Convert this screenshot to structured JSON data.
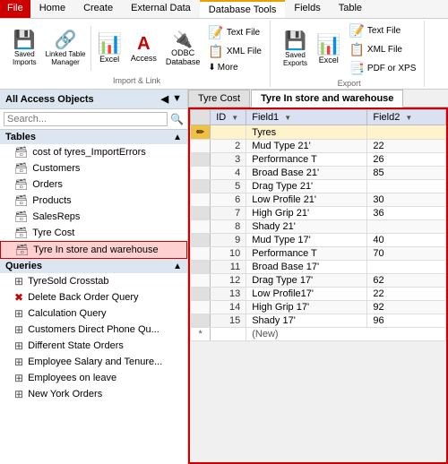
{
  "ribbon": {
    "tabs": [
      {
        "label": "File",
        "active": false,
        "red": true
      },
      {
        "label": "Home",
        "active": false
      },
      {
        "label": "Create",
        "active": false
      },
      {
        "label": "External Data",
        "active": false
      },
      {
        "label": "Database Tools",
        "active": true
      },
      {
        "label": "Fields",
        "active": false
      },
      {
        "label": "Table",
        "active": false
      }
    ],
    "groups": {
      "import_link": {
        "label": "Import & Link",
        "buttons_top": [
          {
            "icon": "💾",
            "label": "Saved\nImports"
          },
          {
            "icon": "🔗",
            "label": "Linked Table\nManager"
          },
          {
            "icon": "📊",
            "label": "Excel"
          },
          {
            "icon": "A",
            "label": "Access"
          },
          {
            "icon": "🔌",
            "label": "ODBC\nDatabase"
          }
        ],
        "buttons_right": [
          {
            "icon": "📝",
            "label": "Text File"
          },
          {
            "icon": "📋",
            "label": "XML File"
          },
          {
            "icon": "▼",
            "label": "More"
          }
        ]
      },
      "export": {
        "label": "Export",
        "buttons": [
          {
            "icon": "💾",
            "label": "Saved\nExports"
          },
          {
            "icon": "📊",
            "label": "Excel"
          },
          {
            "icon": "📄",
            "label": "Text\nFile"
          },
          {
            "icon": "🗂",
            "label": "XML\nFile"
          },
          {
            "icon": "📑",
            "label": "PDF\nor XPS"
          }
        ]
      }
    }
  },
  "left_panel": {
    "title": "All Access Objects",
    "search_placeholder": "Search...",
    "sections": {
      "tables": {
        "label": "Tables",
        "items": [
          {
            "label": "cost of tyres_ImportErrors",
            "icon": "⚠"
          },
          {
            "label": "Customers",
            "icon": "🗃"
          },
          {
            "label": "Orders",
            "icon": "🗃"
          },
          {
            "label": "Products",
            "icon": "🗃"
          },
          {
            "label": "SalesReps",
            "icon": "🗃"
          },
          {
            "label": "Tyre Cost",
            "icon": "🗃"
          },
          {
            "label": "Tyre In store and warehouse",
            "icon": "🗃",
            "active": true
          }
        ]
      },
      "queries": {
        "label": "Queries",
        "items": [
          {
            "label": "TyreSold Crosstab",
            "icon": "⊞"
          },
          {
            "label": "Delete Back Order Query",
            "icon": "✖"
          },
          {
            "label": "Calculation Query",
            "icon": "⊞"
          },
          {
            "label": "Customers Direct Phone Qu...",
            "icon": "⊞"
          },
          {
            "label": "Different State Orders",
            "icon": "⊞"
          },
          {
            "label": "Employee Salary and Tenure...",
            "icon": "⊞"
          },
          {
            "label": "Employees on leave",
            "icon": "⊞"
          },
          {
            "label": "New York Orders",
            "icon": "⊞"
          }
        ]
      }
    }
  },
  "tabs": [
    {
      "label": "Tyre Cost",
      "active": false
    },
    {
      "label": "Tyre In store and warehouse",
      "active": true
    }
  ],
  "table": {
    "columns": [
      {
        "label": "ID",
        "class": "id-col"
      },
      {
        "label": "Field1",
        "class": ""
      },
      {
        "label": "Field2",
        "class": ""
      }
    ],
    "rows": [
      {
        "id": "",
        "field1": "Tyres",
        "field2": "",
        "current": true
      },
      {
        "id": "2",
        "field1": "Mud Type 21'",
        "field2": "22"
      },
      {
        "id": "3",
        "field1": "Performance T",
        "field2": "26"
      },
      {
        "id": "4",
        "field1": "Broad Base 21'",
        "field2": "85"
      },
      {
        "id": "5",
        "field1": "Drag Type 21'",
        "field2": ""
      },
      {
        "id": "6",
        "field1": "Low Profile 21'",
        "field2": "30"
      },
      {
        "id": "7",
        "field1": "High Grip 21'",
        "field2": "36"
      },
      {
        "id": "8",
        "field1": "Shady 21'",
        "field2": ""
      },
      {
        "id": "9",
        "field1": "Mud Type 17'",
        "field2": "40"
      },
      {
        "id": "10",
        "field1": "Performance T",
        "field2": "70"
      },
      {
        "id": "11",
        "field1": "Broad Base 17'",
        "field2": ""
      },
      {
        "id": "12",
        "field1": "Drag Type 17'",
        "field2": "62"
      },
      {
        "id": "13",
        "field1": "Low Profile17'",
        "field2": "22"
      },
      {
        "id": "14",
        "field1": "High Grip 17'",
        "field2": "92"
      },
      {
        "id": "15",
        "field1": "Shady 17'",
        "field2": "96"
      }
    ],
    "new_row_label": "(New)"
  }
}
